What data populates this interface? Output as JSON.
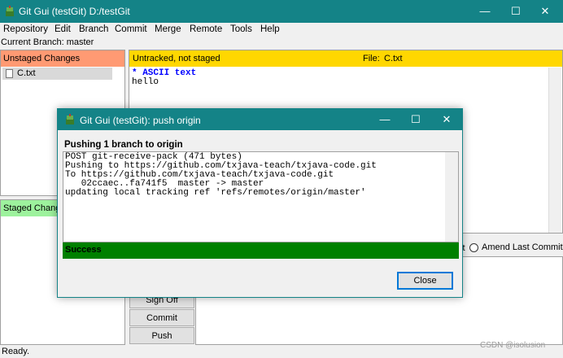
{
  "window": {
    "title": "Git Gui (testGit) D:/testGit",
    "controls": {
      "minimize": "—",
      "maximize": "☐",
      "close": "✕"
    }
  },
  "menu": [
    "Repository",
    "Edit",
    "Branch",
    "Commit",
    "Merge",
    "Remote",
    "Tools",
    "Help"
  ],
  "current_branch": "Current Branch: master",
  "unstaged": {
    "header": "Unstaged Changes",
    "files": [
      "C.txt"
    ]
  },
  "staged": {
    "header": "Staged Changes"
  },
  "diff": {
    "status": "Untracked, not staged",
    "file_label": "File:",
    "file_name": "C.txt",
    "lines": [
      "* ASCII text",
      "hello"
    ]
  },
  "commit_area": {
    "radio_new_fragment": "it",
    "amend_label": "Amend Last Commit",
    "buttons": {
      "sign_off": "Sign Off",
      "commit": "Commit",
      "push": "Push"
    }
  },
  "status_bar": "Ready.",
  "watermark": "CSDN @isolusion",
  "dialog": {
    "title": "Git Gui (testGit): push origin",
    "heading": "Pushing 1 branch to origin",
    "log": [
      "POST git-receive-pack (471 bytes)",
      "Pushing to https://github.com/txjava-teach/txjava-code.git",
      "To https://github.com/txjava-teach/txjava-code.git",
      "   02ccaec..fa741f5  master -> master",
      "updating local tracking ref 'refs/remotes/origin/master'"
    ],
    "result": "Success",
    "close_label": "Close"
  },
  "colors": {
    "titlebar": "#148387",
    "unstaged_header": "#ff9a73",
    "staged_header": "#9df29d",
    "diff_header": "#ffd700",
    "success_bar": "#008000",
    "diff_meta": "#0000ff"
  }
}
